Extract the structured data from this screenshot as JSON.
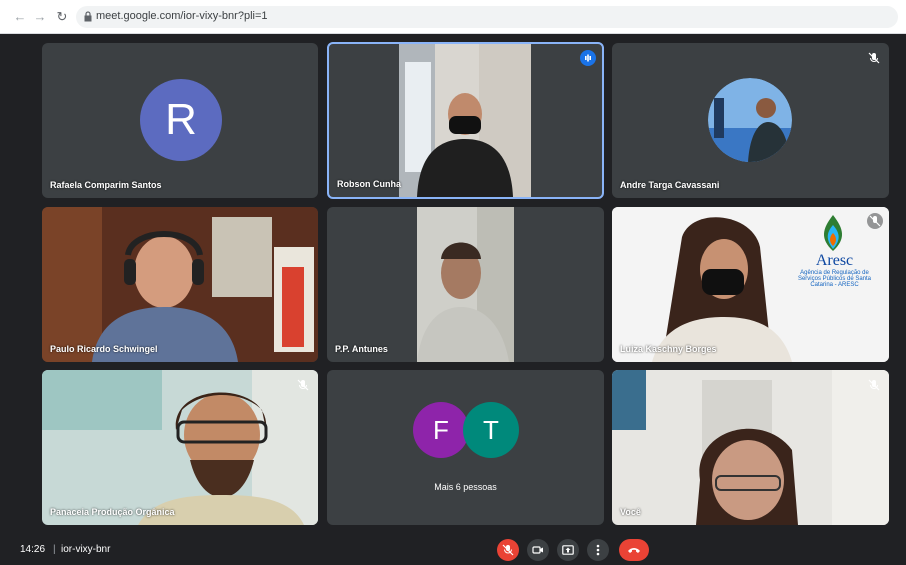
{
  "browser": {
    "url": "meet.google.com/ior-vixy-bnr?pli=1",
    "back_icon": "arrow-left-icon",
    "forward_icon": "arrow-right-icon",
    "reload_icon": "reload-icon",
    "lock_icon": "lock-icon"
  },
  "tiles": [
    {
      "name": "Rafaela Comparim Santos",
      "avatar_letter": "R",
      "avatar_color": "#5c6bc0"
    },
    {
      "name": "Robson Cunha",
      "speaking": true,
      "icon": "speaking-icon"
    },
    {
      "name": "Andre Targa Cavassani",
      "muted": true,
      "icon": "mic-off-icon"
    },
    {
      "name": "Paulo Ricardo Schwingel"
    },
    {
      "name": "P.P. Antunes"
    },
    {
      "name": "Luiza Kaschny Borges",
      "muted": true,
      "icon": "mic-off-icon",
      "logo": {
        "title": "Aresc",
        "lines": [
          "Agência de Regulação de",
          "Serviços Públicos de Santa",
          "Catarina - ARESC"
        ]
      }
    },
    {
      "name": "Panaceia Produção Orgânica",
      "muted": true,
      "icon": "mic-off-icon"
    },
    {
      "name": "Mais 6 pessoas",
      "avatars": [
        {
          "letter": "F",
          "color": "#8e24aa"
        },
        {
          "letter": "T",
          "color": "#00897b"
        }
      ]
    },
    {
      "name": "Você",
      "muted": true,
      "icon": "mic-off-icon"
    }
  ],
  "bottom_bar": {
    "time": "14:26",
    "separator": "|",
    "meeting_code": "ior-vixy-bnr",
    "controls": [
      {
        "name": "microphone-toggle",
        "icon": "mic-off-icon",
        "state": "off",
        "color": "#ea4335"
      },
      {
        "name": "camera-toggle",
        "icon": "camera-icon",
        "color": "#3c4043"
      },
      {
        "name": "present-screen",
        "icon": "present-icon",
        "color": "#3c4043"
      },
      {
        "name": "more-options",
        "icon": "more-vert-icon",
        "color": "#3c4043"
      },
      {
        "name": "leave-call",
        "icon": "call-end-icon",
        "color": "#ea4335"
      }
    ]
  },
  "colors": {
    "background": "#202124",
    "tile": "#3c4043",
    "accent": "#8ab4f8",
    "danger": "#ea4335"
  }
}
